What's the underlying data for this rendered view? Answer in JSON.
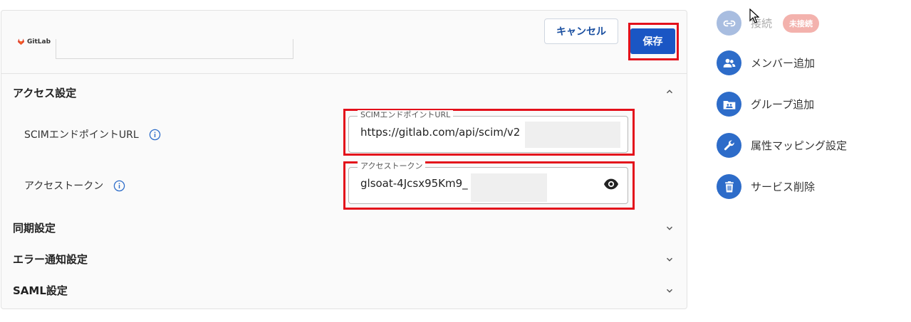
{
  "header": {
    "logo_text": "GitLab",
    "cancel_label": "キャンセル",
    "save_label": "保存"
  },
  "sections": {
    "access": {
      "title": "アクセス設定",
      "scim_label": "SCIMエンドポイントURL",
      "scim_field_legend": "SCIMエンドポイントURL",
      "scim_field_value": "https://gitlab.com/api/scim/v2",
      "token_label": "アクセストークン",
      "token_field_legend": "アクセストークン",
      "token_field_value": "glsoat-4Jcsx95Km9_"
    },
    "sync": {
      "title": "同期設定"
    },
    "error": {
      "title": "エラー通知設定"
    },
    "saml": {
      "title": "SAML設定"
    }
  },
  "sidebar": {
    "items": [
      {
        "label": "接続",
        "badge": "未接続",
        "icon": "link-icon"
      },
      {
        "label": "メンバー追加",
        "icon": "people-icon"
      },
      {
        "label": "グループ追加",
        "icon": "folder-group-icon"
      },
      {
        "label": "属性マッピング設定",
        "icon": "wrench-icon"
      },
      {
        "label": "サービス削除",
        "icon": "trash-icon"
      }
    ]
  },
  "colors": {
    "primary": "#1a56c4",
    "highlight": "#e3101b",
    "badge": "#f3b2ad"
  }
}
